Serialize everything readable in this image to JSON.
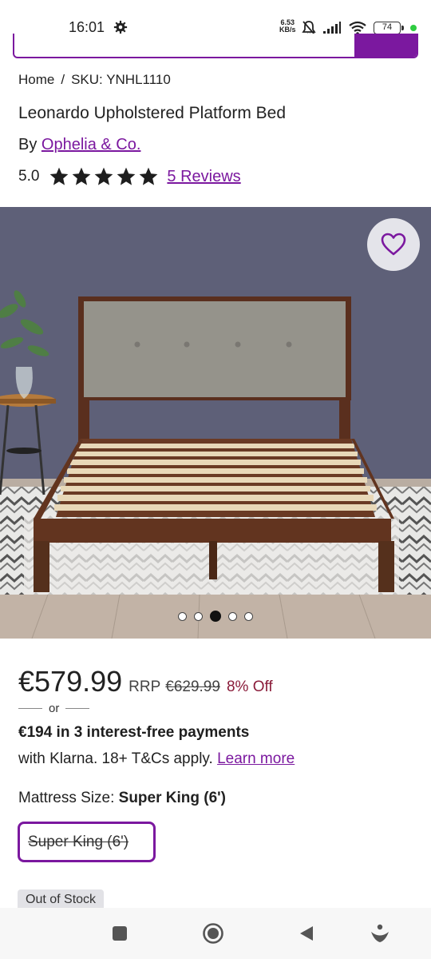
{
  "status_bar": {
    "time": "16:01",
    "net_speed_value": "6.53",
    "net_speed_unit": "KB/s",
    "battery": "74",
    "icons": [
      "settings-icon",
      "bell-off-icon",
      "signal-icon",
      "wifi-icon",
      "battery-icon",
      "active-dot-icon"
    ]
  },
  "breadcrumb": {
    "home": "Home",
    "separator": "/",
    "sku": "SKU: YNHL1110"
  },
  "product": {
    "title": "Leonardo Upholstered Platform Bed",
    "by_label": "By",
    "brand": "Ophelia & Co.",
    "rating": "5.0",
    "stars": 5,
    "reviews_link": "5 Reviews"
  },
  "gallery": {
    "dot_count": 5,
    "active_index": 2,
    "favorite_icon": "heart-icon"
  },
  "pricing": {
    "price": "€579.99",
    "rrp_label": "RRP",
    "rrp": "€629.99",
    "discount": "8% Off",
    "or_text": "or",
    "klarna_line1": "€194 in 3 interest-free payments",
    "klarna_line2": "with Klarna. 18+ T&Cs apply.",
    "learn_more": "Learn more"
  },
  "size": {
    "label": "Mattress Size:",
    "selected": "Super King (6')",
    "option": "Super King (6')"
  },
  "stock": {
    "badge": "Out of Stock"
  },
  "nav": {
    "icons": [
      "recents-square-icon",
      "home-circle-icon",
      "back-triangle-icon",
      "assistant-icon"
    ]
  },
  "colors": {
    "accent": "#7b189f",
    "discount": "#8a1c3a",
    "text": "#1e1e1e"
  }
}
